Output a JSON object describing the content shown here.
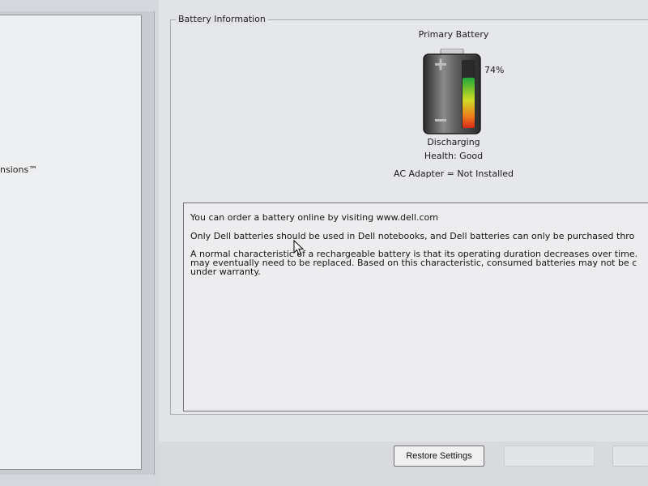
{
  "left_panel": {
    "partial_item_label": "nsions™"
  },
  "group": {
    "legend": "Battery Information"
  },
  "battery": {
    "heading": "Primary Battery",
    "charge_percent": 74,
    "charge_label": "74%",
    "status": "Discharging",
    "health": "Health: Good",
    "ac_adapter": "AC Adapter = Not Installed",
    "fill_colors": [
      "#22a63a",
      "#cfdc24",
      "#ee7a1c",
      "#d62a1a"
    ]
  },
  "info": {
    "line1": "You can order a battery online by visiting www.dell.com",
    "line2": "Only Dell batteries should be used in Dell notebooks, and Dell batteries can only be purchased thro",
    "line3": "A normal characteristic of a rechargeable battery is that its operating duration decreases over time.\nmay eventually need to be replaced.  Based on this characteristic, consumed batteries may not be c\nunder warranty."
  },
  "buttons": {
    "restore_label": "Restore Settings"
  }
}
